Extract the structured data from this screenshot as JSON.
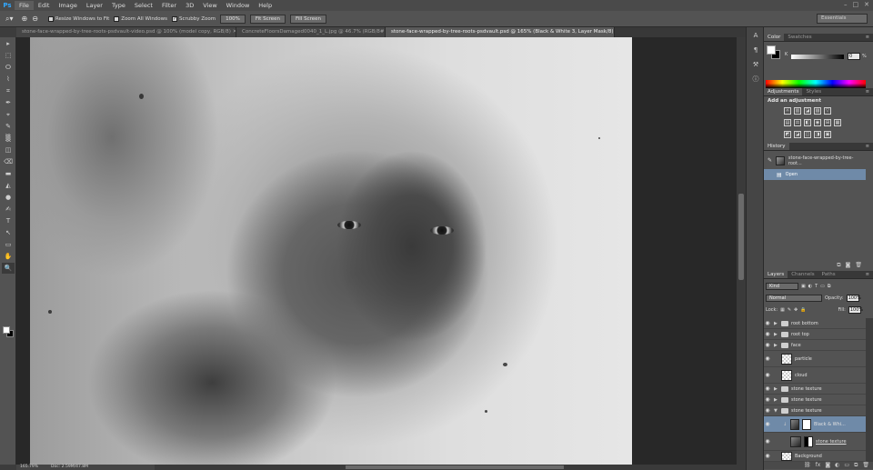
{
  "app": {
    "logo": "Ps",
    "menu": [
      "File",
      "Edit",
      "Image",
      "Layer",
      "Type",
      "Select",
      "Filter",
      "3D",
      "View",
      "Window",
      "Help"
    ],
    "window_controls": [
      "–",
      "□",
      "✕"
    ]
  },
  "options_bar": {
    "tool_icon": "zoom-icon",
    "zoom_in_icon": "zoom-in-icon",
    "zoom_out_icon": "zoom-out-icon",
    "resize_windows_label": "Resize Windows to Fit",
    "zoom_all_windows_label": "Zoom All Windows",
    "scrubby_zoom_label": "Scrubby Zoom",
    "scrubby_checked": "✓",
    "btn_100": "100%",
    "btn_fit_screen": "Fit Screen",
    "btn_fill_screen": "Fill Screen",
    "workspace": "Essentials"
  },
  "tabs": [
    {
      "label": "stone-face-wrapped-by-tree-roots-psdvault-video.psd @ 100% (model copy, RGB/8) ✕"
    },
    {
      "label": "ConcreteFloorsDamaged0040_1_L.jpg @ 46.7% (RGB/8#) ✕"
    },
    {
      "label": "stone-face-wrapped-by-tree-roots-psdvault.psd @ 165% (Black & White 3, Layer Mask/8) ✕"
    }
  ],
  "status": {
    "zoom": "165.79%",
    "doc": "Doc: 2.59M/47.8M"
  },
  "panels": {
    "color": {
      "tabs": [
        "Color",
        "Swatches"
      ],
      "channel_label": "K",
      "value": "0",
      "percent": "%"
    },
    "adjustments": {
      "tabs": [
        "Adjustments",
        "Styles"
      ],
      "title": "Add an adjustment",
      "row1": [
        "☼",
        "▥",
        "◪",
        "▨",
        "▽"
      ],
      "row2": [
        "▤",
        "⚖",
        "◧",
        "◉",
        "⊞",
        "▦"
      ],
      "row3": [
        "◩",
        "◪",
        "◫",
        "◨",
        "▣"
      ]
    },
    "history": {
      "tabs": [
        "History"
      ],
      "snapshot": "stone-face-wrapped-by-tree-root...",
      "open": "Open",
      "footer_icons": [
        "⧉",
        "◙",
        "🗑"
      ]
    },
    "layers": {
      "tabs": [
        "Layers",
        "Channels",
        "Paths"
      ],
      "kind": "Kind",
      "blend": "Normal",
      "opacity_label": "Opacity:",
      "opacity": "100%",
      "lock_label": "Lock:",
      "fill_label": "Fill:",
      "fill": "100%",
      "items": [
        {
          "name": "root bottom",
          "type": "folder"
        },
        {
          "name": "root top",
          "type": "folder"
        },
        {
          "name": "face",
          "type": "folder"
        },
        {
          "name": "particle",
          "type": "pixel"
        },
        {
          "name": "cloud",
          "type": "pixel"
        },
        {
          "name": "stone texture",
          "type": "folder"
        },
        {
          "name": "stone texture",
          "type": "folder"
        },
        {
          "name": "stone texture",
          "type": "folder-open"
        },
        {
          "name": "Black & Whi...",
          "type": "adjustment"
        },
        {
          "name": "stone texture",
          "type": "masked"
        },
        {
          "name": "Background",
          "type": "pixel"
        }
      ],
      "footer_icons": [
        "⛓",
        "fx",
        "◙",
        "◐",
        "▭",
        "⧉",
        "🗑"
      ]
    }
  },
  "tools": [
    "▸",
    "⬚",
    "ⵔ",
    "⌇",
    "⌗",
    "✒",
    "⌖",
    "✎",
    "▒",
    "◫",
    "⌫",
    "▬",
    "◭",
    "●",
    "✍",
    "T",
    "↖",
    "▭",
    "✋",
    "🔍"
  ]
}
